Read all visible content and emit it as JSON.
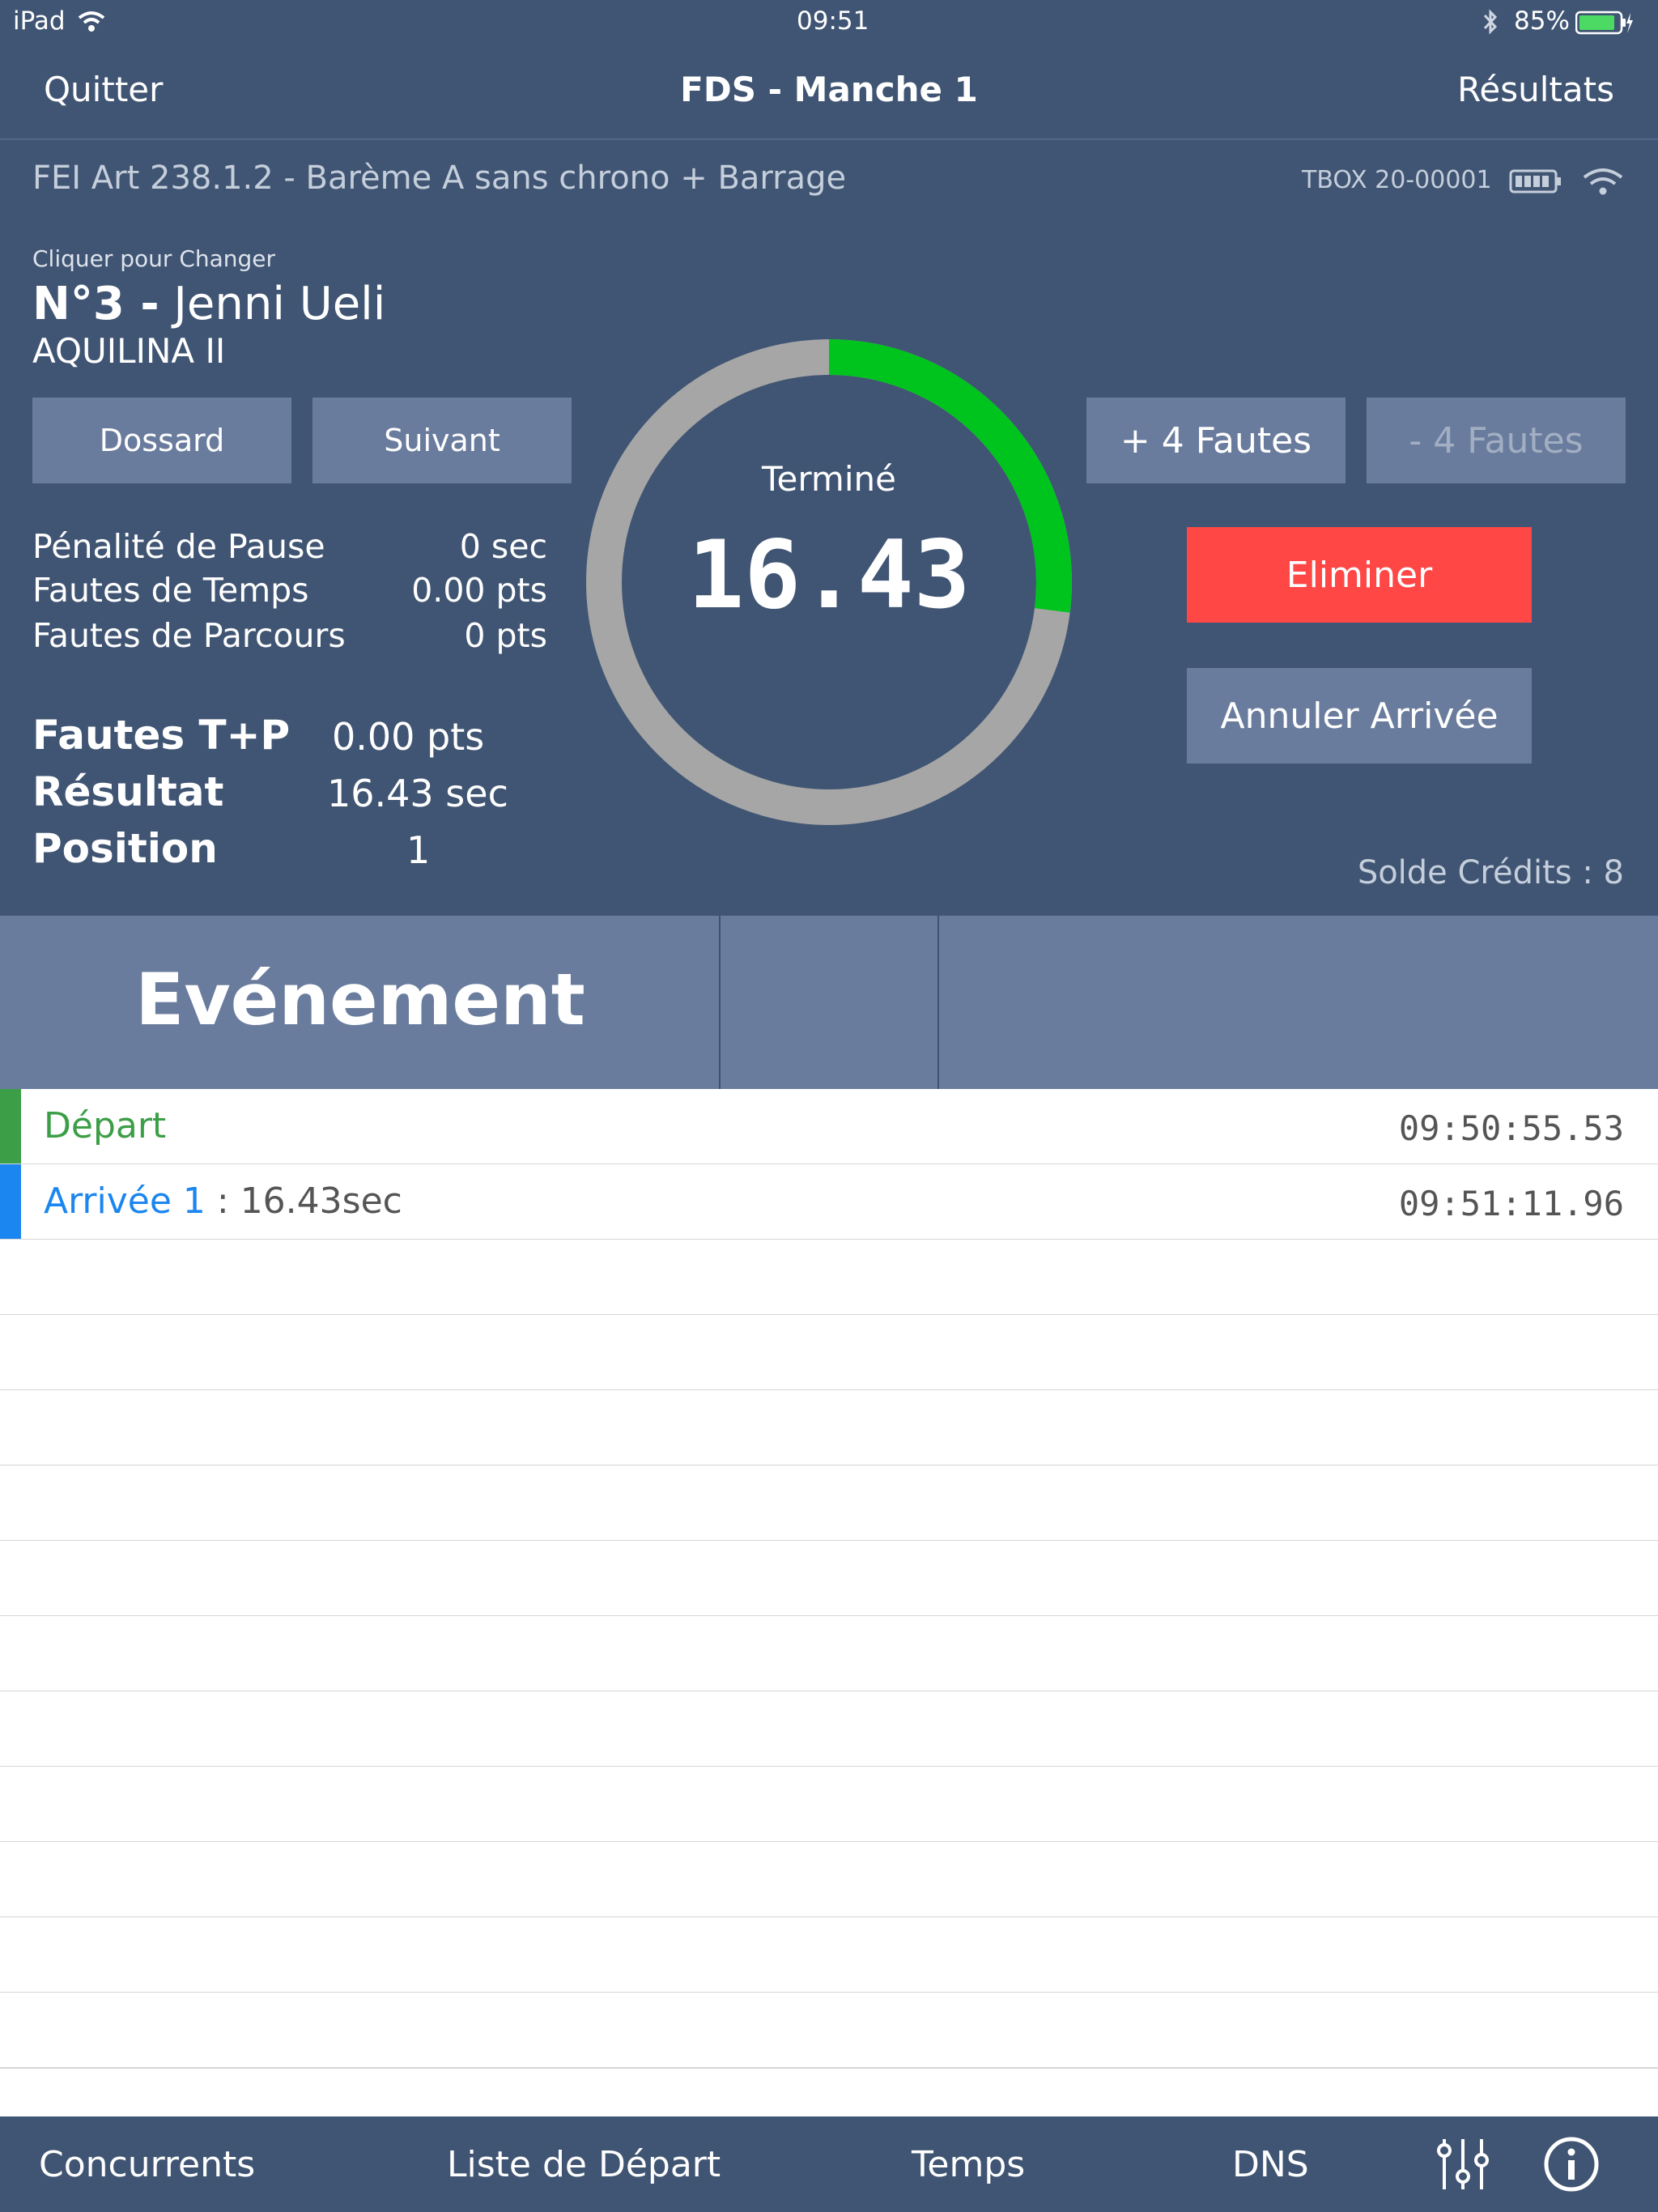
{
  "status_bar": {
    "device": "iPad",
    "time": "09:51",
    "battery": "85%"
  },
  "nav": {
    "left": "Quitter",
    "title": "FDS - Manche 1",
    "right": "Résultats"
  },
  "rules": {
    "text": "FEI Art 238.1.2 - Barème A sans chrono + Barrage",
    "device_id": "TBOX 20-00001"
  },
  "rider": {
    "hint": "Cliquer pour Changer",
    "number": "N°3 -",
    "name": "Jenni Ueli",
    "horse": "AQUILINA II"
  },
  "buttons": {
    "dossard": "Dossard",
    "suivant": "Suivant",
    "plus_faults": "+ 4 Fautes",
    "minus_faults": "- 4 Fautes",
    "eliminate": "Eliminer",
    "cancel_arrival": "Annuler Arrivée"
  },
  "penalties": [
    {
      "label": "Pénalité de Pause",
      "value": "0 sec"
    },
    {
      "label": "Fautes de Temps",
      "value": "0.00 pts"
    },
    {
      "label": "Fautes de Parcours",
      "value": "0 pts"
    }
  ],
  "summary": [
    {
      "label": "Fautes T+P",
      "value": "0.00 pts"
    },
    {
      "label": "Résultat",
      "value": "16.43 sec"
    },
    {
      "label": "Position",
      "value": "1"
    }
  ],
  "timer": {
    "state": "Terminé",
    "value": "16.43",
    "progress": 0.27,
    "progress_color": "#00c41e",
    "track_color": "#a6a6a6"
  },
  "credits": "Solde Crédits : 8",
  "events_header": "Evénement",
  "events": [
    {
      "label": "Départ",
      "detail": "",
      "time": "09:50:55.53",
      "color": "#3c9e47"
    },
    {
      "label": "Arrivée 1",
      "detail": " : 16.43sec",
      "time": "09:51:11.96",
      "color": "#1b86f0"
    }
  ],
  "tabs": {
    "concurrents": "Concurrents",
    "liste": "Liste de Départ",
    "temps": "Temps",
    "dns": "DNS"
  },
  "colors": {
    "navy": "#405573",
    "button": "#6a7c9d",
    "danger": "#ff4746",
    "green": "#00c41e"
  }
}
